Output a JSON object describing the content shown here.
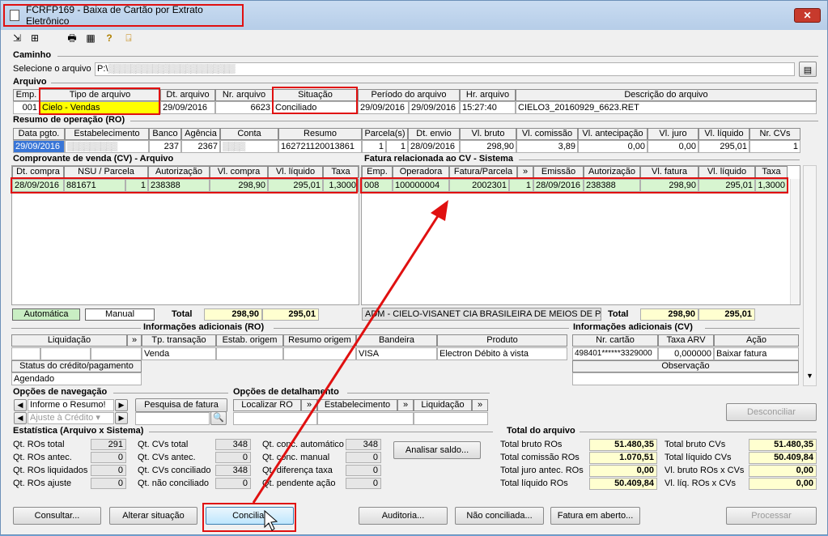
{
  "window": {
    "title": "FCRFP169 - Baixa de Cartão por Extrato Eletrônico",
    "close": "✕"
  },
  "caminho": {
    "section": "Caminho",
    "label": "Selecione o arquivo",
    "value": "P:\\"
  },
  "arquivo": {
    "section": "Arquivo",
    "headers": [
      "Emp.",
      "Tipo de arquivo",
      "Dt. arquivo",
      "Nr. arquivo",
      "Situação",
      "Período do arquivo",
      "Hr. arquivo",
      "Descrição do arquivo"
    ],
    "row": {
      "emp": "001",
      "tipo": "Cielo - Vendas",
      "dt": "29/09/2016",
      "nr": "6623",
      "situacao": "Conciliado",
      "per_ini": "29/09/2016",
      "per_fim": "29/09/2016",
      "hr": "15:27:40",
      "desc": "CIELO3_20160929_6623.RET"
    }
  },
  "ro": {
    "section": "Resumo de operação (RO)",
    "headers": [
      "Data pgto.",
      "Estabelecimento",
      "Banco",
      "Agência",
      "Conta",
      "Resumo",
      "Parcela(s)",
      "Dt. envio",
      "Vl. bruto",
      "Vl. comissão",
      "Vl. antecipação",
      "Vl. juro",
      "Vl. líquido",
      "Nr. CVs"
    ],
    "row": {
      "data": "29/09/2016",
      "banco": "237",
      "agencia": "2367",
      "resumo": "162721120013861",
      "parc1": "1",
      "parc2": "1",
      "envio": "28/09/2016",
      "bruto": "298,90",
      "comissao": "3,89",
      "antec": "0,00",
      "juro": "0,00",
      "liquido": "295,01",
      "ncvs": "1"
    }
  },
  "cv": {
    "section": "Comprovante de venda (CV) - Arquivo",
    "headers": [
      "Dt. compra",
      "NSU / Parcela",
      "Autorização",
      "Vl. compra",
      "Vl. líquido",
      "Taxa"
    ],
    "row": {
      "dt": "28/09/2016",
      "nsu": "881671",
      "parc": "1",
      "aut": "238388",
      "compra": "298,90",
      "liquido": "295,01",
      "taxa": "1,3000"
    },
    "automatica": "Automática",
    "manual": "Manual",
    "total_label": "Total",
    "total_compra": "298,90",
    "total_liquido": "295,01"
  },
  "fatura": {
    "section": "Fatura relacionada ao CV - Sistema",
    "headers": [
      "Emp.",
      "Operadora",
      "Fatura/Parcela",
      "»",
      "Emissão",
      "Autorização",
      "Vl. fatura",
      "Vl. líquido",
      "Taxa"
    ],
    "row": {
      "emp": "008",
      "oper": "100000004",
      "fatura": "2002301",
      "parc": "1",
      "emissao": "28/09/2016",
      "aut": "238388",
      "vfat": "298,90",
      "liquido": "295,01",
      "taxa": "1,3000"
    },
    "adm": "ADM - CIELO-VISANET CIA BRASILEIRA DE MEIOS DE PAGAI",
    "total_label": "Total",
    "total_fatura": "298,90",
    "total_liquido": "295,01"
  },
  "info_ro": {
    "section": "Informações adicionais (RO)",
    "liquidacao": "Liquidação",
    "arrow": "»",
    "tp": "Tp. transação",
    "estab": "Estab. origem",
    "resumo": "Resumo origem",
    "bandeira": "Bandeira",
    "produto": "Produto",
    "tp_val": "Venda",
    "bandeira_val": "VISA",
    "produto_val": "Electron Débito à vista",
    "status_label": "Status do crédito/pagamento",
    "status_val": "Agendado"
  },
  "info_cv": {
    "section": "Informações adicionais (CV)",
    "nr": "Nr. cartão",
    "taxa": "Taxa ARV",
    "acao": "Ação",
    "nr_val": "498401******3329000",
    "taxa_val": "0,000000",
    "acao_val": "Baixar fatura",
    "obs": "Observação"
  },
  "nav": {
    "section": "Opções de navegação",
    "informe": "Informe o Resumo!",
    "ajuste": "Ajuste à Crédito",
    "pesquisa": "Pesquisa de fatura"
  },
  "detalhe": {
    "section": "Opções de detalhamento",
    "localizar": "Localizar RO",
    "estab": "Estabelecimento",
    "liquidacao": "Liquidação",
    "arrow": "»"
  },
  "desconciliar": "Desconciliar",
  "estat": {
    "section": "Estatística (Arquivo x Sistema)",
    "col1": [
      {
        "l": "Qt. ROs total",
        "v": "291"
      },
      {
        "l": "Qt. ROs antec.",
        "v": "0"
      },
      {
        "l": "Qt. ROs liquidados",
        "v": "0"
      },
      {
        "l": "Qt. ROs ajuste",
        "v": "0"
      }
    ],
    "col2": [
      {
        "l": "Qt. CVs total",
        "v": "348"
      },
      {
        "l": "Qt. CVs antec.",
        "v": "0"
      },
      {
        "l": "Qt. CVs conciliado",
        "v": "348"
      },
      {
        "l": "Qt. não conciliado",
        "v": "0"
      }
    ],
    "col3": [
      {
        "l": "Qt. conc. automático",
        "v": "348"
      },
      {
        "l": "Qt. conc. manual",
        "v": "0"
      },
      {
        "l": "Qt. diferença taxa",
        "v": "0"
      },
      {
        "l": "Qt. pendente ação",
        "v": "0"
      }
    ],
    "analisar": "Analisar saldo..."
  },
  "total_arq": {
    "section": "Total do arquivo",
    "left": [
      {
        "l": "Total bruto ROs",
        "v": "51.480,35"
      },
      {
        "l": "Total comissão ROs",
        "v": "1.070,51"
      },
      {
        "l": "Total juro antec. ROs",
        "v": "0,00"
      },
      {
        "l": "Total líquido ROs",
        "v": "50.409,84"
      }
    ],
    "right": [
      {
        "l": "Total bruto CVs",
        "v": "51.480,35"
      },
      {
        "l": "Total líquido CVs",
        "v": "50.409,84"
      },
      {
        "l": "Vl. bruto ROs x CVs",
        "v": "0,00"
      },
      {
        "l": "Vl. líq. ROs x CVs",
        "v": "0,00"
      }
    ]
  },
  "buttons": {
    "consultar": "Consultar...",
    "alterar": "Alterar situação",
    "conciliar": "Conciliar",
    "auditoria": "Auditoria...",
    "nao_conc": "Não conciliada...",
    "fatura_aberto": "Fatura em aberto...",
    "processar": "Processar"
  }
}
